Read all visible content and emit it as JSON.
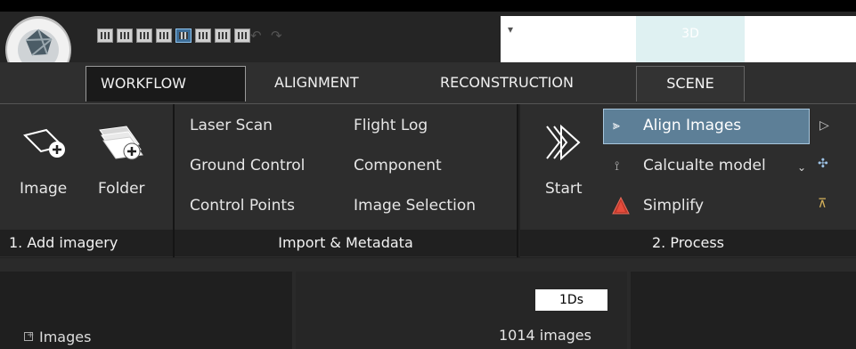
{
  "tabs": [
    {
      "label": "WORKFLOW"
    },
    {
      "label": "ALIGNMENT"
    },
    {
      "label": "RECONSTRUCTION"
    },
    {
      "label": "SCENE"
    }
  ],
  "view_toggle_label": "3D",
  "add_imagery": {
    "image_label": "Image",
    "folder_label": "Folder",
    "group_label": "1. Add imagery"
  },
  "import_metadata": {
    "col1": [
      "Laser Scan",
      "Ground Control",
      "Control Points"
    ],
    "col2": [
      "Flight Log",
      "Component",
      "Image Selection"
    ],
    "group_label": "Import & Metadata"
  },
  "process": {
    "start_label": "Start",
    "align_label": "Align Images",
    "calculate_label": "Calcualte model",
    "simplify_label": "Simplify",
    "group_label": "2. Process"
  },
  "lower": {
    "badge": "1Ds",
    "image_count": "1014 images",
    "tree_images": "Images"
  }
}
